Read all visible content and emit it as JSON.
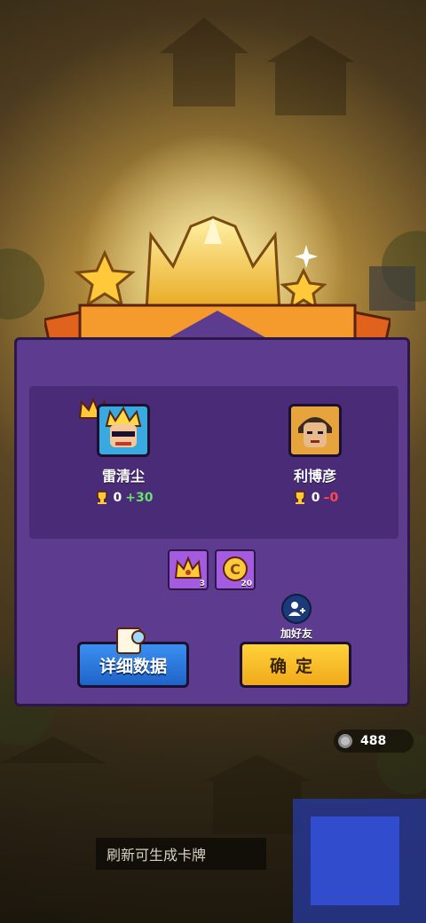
{
  "players": [
    {
      "name": "雷清尘",
      "trophies": "0",
      "delta": "+30",
      "crowned": true
    },
    {
      "name": "利博彦",
      "trophies": "0",
      "delta": "–0",
      "crowned": false
    }
  ],
  "rewards": [
    {
      "icon": "crown-icon",
      "count": "3"
    },
    {
      "icon": "coin-icon",
      "count": "20"
    }
  ],
  "add_friend_label": "加好友",
  "buttons": {
    "details": "详细数据",
    "confirm": "确定"
  },
  "coin_balance": "488",
  "bottom_banner": "刷新可生成卡牌",
  "colors": {
    "panel": "#5d3b8e",
    "confirm": "#ffd23a",
    "details": "#2f7fe0",
    "gain": "#66e36a",
    "loss": "#ff4a4a"
  }
}
